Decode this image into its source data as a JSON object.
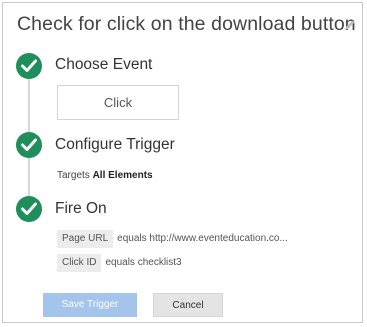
{
  "dialog": {
    "title": "Check for click on the download button",
    "edit_icon": "pencil-icon"
  },
  "steps": [
    {
      "title": "Choose Event",
      "icon": "check-circle-icon",
      "event_value": "Click"
    },
    {
      "title": "Configure Trigger",
      "icon": "check-circle-icon",
      "targets_prefix": "Targets",
      "targets_value": "All Elements"
    },
    {
      "title": "Fire On",
      "icon": "check-circle-icon",
      "conditions": [
        {
          "variable": "Page URL",
          "text": "equals http://www.eventeducation.co..."
        },
        {
          "variable": "Click ID",
          "text": "equals checklist3"
        }
      ]
    }
  ],
  "buttons": {
    "save_label": "Save Trigger",
    "cancel_label": "Cancel"
  },
  "colors": {
    "check_green": "#1e8e5a",
    "save_disabled": "#a4c4ec"
  }
}
